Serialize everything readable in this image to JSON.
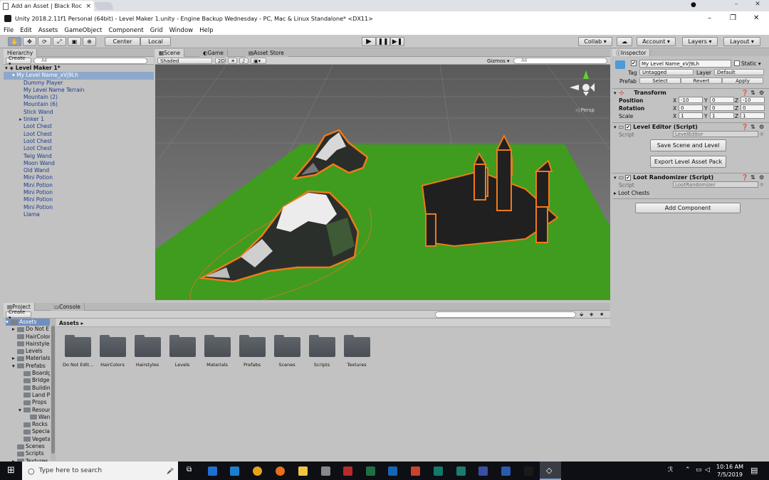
{
  "browser": {
    "tab_title": "Add an Asset | Black Roc",
    "tab_close": "×"
  },
  "window": {
    "title": "Unity 2018.2.11f1 Personal (64bit) - Level Maker 1.unity - Engine Backup Wednesday - PC, Mac & Linux Standalone* <DX11>",
    "min": "–",
    "max": "❐",
    "close": "✕"
  },
  "menu": [
    "File",
    "Edit",
    "Assets",
    "GameObject",
    "Component",
    "Grid",
    "Window",
    "Help"
  ],
  "toolbar": {
    "pivot": "Center",
    "space": "Local",
    "collab": "Collab ▾",
    "account": "Account ▾",
    "layers": "Layers ▾",
    "layout": "Layout ▾"
  },
  "hierarchy": {
    "tab": "Hierarchy",
    "create": "Create ▾",
    "search_placeholder": "All",
    "scene_root": "Level Maker 1*",
    "selected": "My Level Name_xVj9Lh",
    "items": [
      "Dummy Player",
      "My Level Name Terrain",
      "Mountain (2)",
      "Mountain (6)",
      "Stick Wand",
      "tinker 1",
      "Loot Chest",
      "Loot Chest",
      "Loot Chest",
      "Loot Chest",
      "Twig Wand",
      "Moon Wand",
      "Old Wand",
      "Mini Potion",
      "Mini Potion",
      "Mini Potion",
      "Mini Potion",
      "Mini Potion",
      "Llama"
    ]
  },
  "scene_view": {
    "tabs": [
      "Scene",
      "Game",
      "Asset Store"
    ],
    "shading": "Shaded",
    "mode_2d": "2D",
    "gizmos": "Gizmos ▾",
    "search_placeholder": "All",
    "persp_label": "◁ Persp",
    "colors": {
      "ground": "#3f9c1e",
      "selection": "#f07a1a",
      "sky": "#6e6e6e"
    }
  },
  "inspector": {
    "tab": "Inspector",
    "object_name": "My Level Name_xVj9Lh",
    "static_label": "Static ▾",
    "tag_label": "Tag",
    "tag_value": "Untagged",
    "layer_label": "Layer",
    "layer_value": "Default",
    "prefab_label": "Prefab",
    "prefab_buttons": [
      "Select",
      "Revert",
      "Apply"
    ],
    "transform": {
      "title": "Transform",
      "position_label": "Position",
      "position": {
        "x": "-10",
        "y": "0",
        "z": "-10"
      },
      "rotation_label": "Rotation",
      "rotation": {
        "x": "0",
        "y": "0",
        "z": "0"
      },
      "scale_label": "Scale",
      "scale": {
        "x": "1",
        "y": "1",
        "z": "1"
      }
    },
    "level_editor": {
      "title": "Level Editor (Script)",
      "script_label": "Script",
      "script_value": "LevelEditor",
      "btn_save": "Save Scene and Level",
      "btn_export": "Export Level Asset Pack"
    },
    "loot_randomizer": {
      "title": "Loot Randomizer (Script)",
      "script_label": "Script",
      "script_value": "LootRandomizer",
      "field_loot": "Loot Chests"
    },
    "add_component": "Add Component"
  },
  "project": {
    "tabs": [
      "Project",
      "Console"
    ],
    "create": "Create ▾",
    "breadcrumb": "Assets ▸",
    "tree": [
      {
        "label": "Assets",
        "indent": 0,
        "selected": true
      },
      {
        "label": "Do Not E",
        "indent": 1
      },
      {
        "label": "HairColor",
        "indent": 1
      },
      {
        "label": "Hairstyles",
        "indent": 1
      },
      {
        "label": "Levels",
        "indent": 1
      },
      {
        "label": "Materials",
        "indent": 1
      },
      {
        "label": "Prefabs",
        "indent": 1
      },
      {
        "label": "Boardg",
        "indent": 2
      },
      {
        "label": "Bridge",
        "indent": 2
      },
      {
        "label": "Buildin",
        "indent": 2
      },
      {
        "label": "Land Pl",
        "indent": 2
      },
      {
        "label": "Props",
        "indent": 2
      },
      {
        "label": "Resour",
        "indent": 2
      },
      {
        "label": "Wan",
        "indent": 3
      },
      {
        "label": "Rocks",
        "indent": 2
      },
      {
        "label": "Specia",
        "indent": 2
      },
      {
        "label": "Vegeta",
        "indent": 2
      },
      {
        "label": "Scenes",
        "indent": 1
      },
      {
        "label": "Scripts",
        "indent": 1
      },
      {
        "label": "Textures",
        "indent": 1
      }
    ],
    "folders": [
      "Do Not Edit...",
      "HairColors",
      "Hairstyles",
      "Levels",
      "Materials",
      "Prefabs",
      "Scenes",
      "Scripts",
      "Textures"
    ]
  },
  "taskbar": {
    "search_placeholder": "Type here to search",
    "time": "10:16 AM",
    "date": "7/5/2019"
  }
}
